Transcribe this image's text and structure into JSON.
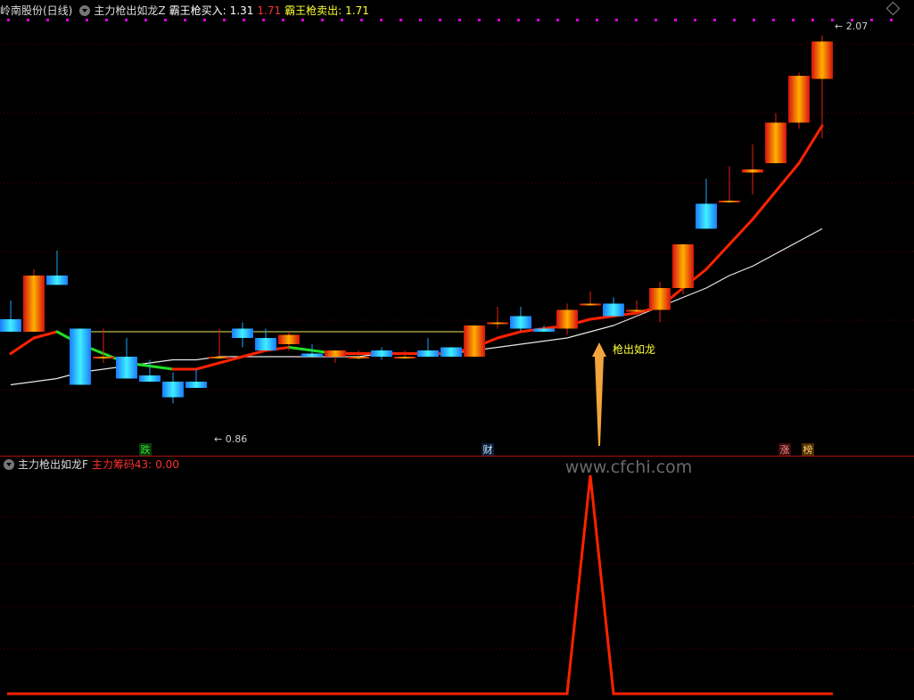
{
  "header": {
    "stock": "岭南股份(日线)",
    "indicator": "主力枪出如龙Z",
    "buy_label": "霸王枪买入:",
    "buy_value": "1.31",
    "extra_value": "1.71",
    "sell_label": "霸王枪卖出:",
    "sell_value": "1.71"
  },
  "sub_header": {
    "indicator": "主力枪出如龙F",
    "label": "主力筹码43:",
    "value": "0.00"
  },
  "colors": {
    "up": "#e41f12",
    "down": "#19a6ff",
    "ma_red": "#ff2200",
    "ma_green": "#21e021",
    "white_line": "#e8e8e8",
    "yellow_line": "#e8e860",
    "label_yellow": "#ffff33",
    "magenta": "#e000e0",
    "arrow": "#f2a53c"
  },
  "icons": {
    "toggle": "collapse-circle-icon",
    "settings": "diamond-icon"
  },
  "annotations": {
    "low_price": "0.86",
    "high_price": "2.07",
    "signal": "枪出如龙",
    "watermark": "www.cfchi.com",
    "markers": [
      "跌",
      "财",
      "涨",
      "榜"
    ]
  },
  "chart_data": [
    {
      "type": "candlestick",
      "title": "岭南股份(日线)",
      "ylim": [
        0.8,
        2.12
      ],
      "candles": [
        {
          "o": 1.16,
          "h": 1.22,
          "l": 1.12,
          "c": 1.12
        },
        {
          "o": 1.12,
          "h": 1.32,
          "l": 1.12,
          "c": 1.3
        },
        {
          "o": 1.3,
          "h": 1.38,
          "l": 1.28,
          "c": 1.27
        },
        {
          "o": 1.13,
          "h": 1.13,
          "l": 0.95,
          "c": 0.95
        },
        {
          "o": 1.04,
          "h": 1.13,
          "l": 1.02,
          "c": 1.04
        },
        {
          "o": 1.04,
          "h": 1.1,
          "l": 0.97,
          "c": 0.97
        },
        {
          "o": 0.98,
          "h": 1.03,
          "l": 0.98,
          "c": 0.96
        },
        {
          "o": 0.96,
          "h": 0.99,
          "l": 0.89,
          "c": 0.91
        },
        {
          "o": 0.96,
          "h": 1.0,
          "l": 0.94,
          "c": 0.94
        },
        {
          "o": 1.04,
          "h": 1.13,
          "l": 1.04,
          "c": 1.04
        },
        {
          "o": 1.13,
          "h": 1.15,
          "l": 1.07,
          "c": 1.1
        },
        {
          "o": 1.1,
          "h": 1.13,
          "l": 1.06,
          "c": 1.06
        },
        {
          "o": 1.08,
          "h": 1.12,
          "l": 1.06,
          "c": 1.11
        },
        {
          "o": 1.05,
          "h": 1.08,
          "l": 1.04,
          "c": 1.04
        },
        {
          "o": 1.04,
          "h": 1.06,
          "l": 1.02,
          "c": 1.06
        },
        {
          "o": 1.04,
          "h": 1.06,
          "l": 1.03,
          "c": 1.04
        },
        {
          "o": 1.06,
          "h": 1.07,
          "l": 1.03,
          "c": 1.04
        },
        {
          "o": 1.04,
          "h": 1.06,
          "l": 1.04,
          "c": 1.04
        },
        {
          "o": 1.06,
          "h": 1.1,
          "l": 1.06,
          "c": 1.04
        },
        {
          "o": 1.07,
          "h": 1.07,
          "l": 1.04,
          "c": 1.04
        },
        {
          "o": 1.04,
          "h": 1.14,
          "l": 1.04,
          "c": 1.14
        },
        {
          "o": 1.15,
          "h": 1.2,
          "l": 1.13,
          "c": 1.15
        },
        {
          "o": 1.17,
          "h": 1.2,
          "l": 1.12,
          "c": 1.13
        },
        {
          "o": 1.13,
          "h": 1.14,
          "l": 1.12,
          "c": 1.12
        },
        {
          "o": 1.13,
          "h": 1.21,
          "l": 1.11,
          "c": 1.19
        },
        {
          "o": 1.21,
          "h": 1.25,
          "l": 1.21,
          "c": 1.21
        },
        {
          "o": 1.21,
          "h": 1.23,
          "l": 1.17,
          "c": 1.17
        },
        {
          "o": 1.19,
          "h": 1.22,
          "l": 1.17,
          "c": 1.19
        },
        {
          "o": 1.19,
          "h": 1.28,
          "l": 1.15,
          "c": 1.26
        },
        {
          "o": 1.26,
          "h": 1.4,
          "l": 1.24,
          "c": 1.4
        },
        {
          "o": 1.53,
          "h": 1.61,
          "l": 1.45,
          "c": 1.45
        },
        {
          "o": 1.54,
          "h": 1.65,
          "l": 1.54,
          "c": 1.54
        },
        {
          "o": 1.63,
          "h": 1.72,
          "l": 1.56,
          "c": 1.64
        },
        {
          "o": 1.66,
          "h": 1.82,
          "l": 1.66,
          "c": 1.79
        },
        {
          "o": 1.79,
          "h": 1.95,
          "l": 1.77,
          "c": 1.94
        },
        {
          "o": 1.93,
          "h": 2.07,
          "l": 1.74,
          "c": 2.05
        }
      ],
      "series": [
        {
          "values": [
            1.05,
            1.1,
            1.12,
            1.08,
            1.05,
            1.02,
            1.01,
            1.0,
            1.0,
            1.02,
            1.04,
            1.06,
            1.07,
            1.06,
            1.05,
            1.05,
            1.05,
            1.05,
            1.05,
            1.05,
            1.07,
            1.1,
            1.12,
            1.13,
            1.14,
            1.16,
            1.17,
            1.18,
            1.2,
            1.26,
            1.32,
            1.4,
            1.48,
            1.57,
            1.66,
            1.78
          ]
        },
        {
          "values": [
            0.95,
            0.96,
            0.97,
            0.99,
            1.0,
            1.01,
            1.02,
            1.03,
            1.03,
            1.04,
            1.04,
            1.04,
            1.04,
            1.04,
            1.04,
            1.04,
            1.05,
            1.05,
            1.05,
            1.05,
            1.06,
            1.07,
            1.08,
            1.09,
            1.1,
            1.12,
            1.14,
            1.17,
            1.2,
            1.23,
            1.26,
            1.3,
            1.33,
            1.37,
            1.41,
            1.45
          ]
        }
      ]
    },
    {
      "type": "line",
      "title": "主力枪出如龙F",
      "ylim": [
        0,
        43
      ],
      "series": [
        {
          "values": [
            0,
            0,
            0,
            0,
            0,
            0,
            0,
            0,
            0,
            0,
            0,
            0,
            0,
            0,
            0,
            0,
            0,
            0,
            0,
            0,
            0,
            0,
            0,
            0,
            0,
            43,
            0,
            0,
            0,
            0,
            0,
            0,
            0,
            0,
            0,
            0
          ]
        }
      ]
    }
  ]
}
